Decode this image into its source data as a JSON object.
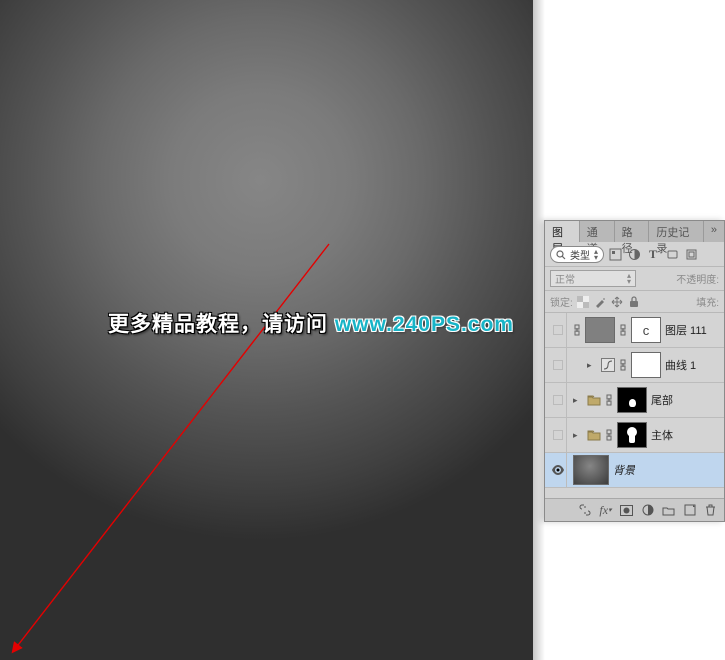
{
  "watermark": {
    "cn": "更多精品教程，请访问 ",
    "url": "www.240PS.com"
  },
  "panel": {
    "tabs": [
      "图层",
      "通道",
      "路径",
      "历史记录"
    ],
    "active_tab": 0,
    "tabs_overflow": "»",
    "filter": {
      "kind_label": "类型"
    },
    "blend": {
      "mode": "正常",
      "opacity_label": "不透明度:"
    },
    "lock": {
      "label": "锁定:",
      "fill_label": "填充:"
    },
    "layers": [
      {
        "kind": "adjustment",
        "name": "图层 111",
        "visible": false,
        "selected": false,
        "mask": "c"
      },
      {
        "kind": "curves",
        "name": "曲线 1",
        "visible": false,
        "selected": false,
        "mask": "white"
      },
      {
        "kind": "group",
        "name": "尾部",
        "visible": false,
        "selected": false,
        "mask": "blob"
      },
      {
        "kind": "group",
        "name": "主体",
        "visible": false,
        "selected": false,
        "mask": "bulb"
      },
      {
        "kind": "bg",
        "name": "背景",
        "visible": true,
        "selected": true,
        "italic": true
      }
    ]
  }
}
